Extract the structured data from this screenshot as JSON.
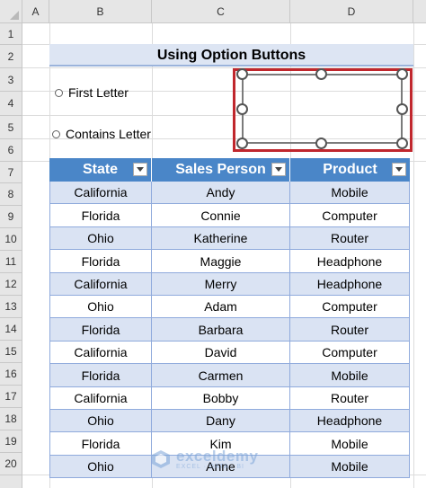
{
  "sheet": {
    "columns": [
      "A",
      "B",
      "C",
      "D"
    ],
    "rows": [
      "1",
      "2",
      "3",
      "4",
      "5",
      "6",
      "7",
      "8",
      "9",
      "10",
      "11",
      "12",
      "13",
      "14",
      "15",
      "16",
      "17",
      "18",
      "19",
      "20"
    ]
  },
  "title": "Using Option Buttons",
  "options": [
    {
      "label": "First Letter",
      "selected": false
    },
    {
      "label": "Contains Letter",
      "selected": false
    }
  ],
  "table": {
    "headers": [
      "State",
      "Sales Person",
      "Product"
    ],
    "rows": [
      [
        "California",
        "Andy",
        "Mobile"
      ],
      [
        "Florida",
        "Connie",
        "Computer"
      ],
      [
        "Ohio",
        "Katherine",
        "Router"
      ],
      [
        "Florida",
        "Maggie",
        "Headphone"
      ],
      [
        "California",
        "Merry",
        "Headphone"
      ],
      [
        "Ohio",
        "Adam",
        "Computer"
      ],
      [
        "Florida",
        "Barbara",
        "Router"
      ],
      [
        "California",
        "David",
        "Computer"
      ],
      [
        "Florida",
        "Carmen",
        "Mobile"
      ],
      [
        "California",
        "Bobby",
        "Router"
      ],
      [
        "Ohio",
        "Dany",
        "Headphone"
      ],
      [
        "Florida",
        "Kim",
        "Mobile"
      ],
      [
        "Ohio",
        "Anne",
        "Mobile"
      ]
    ]
  },
  "watermark": {
    "brand": "exceldemy",
    "sub": "EXCEL · DATA · BI"
  },
  "colors": {
    "header_fill": "#4a86c8",
    "band_fill": "#dde5f3",
    "shape_highlight": "#c0272d",
    "table_border": "#8faadc"
  }
}
